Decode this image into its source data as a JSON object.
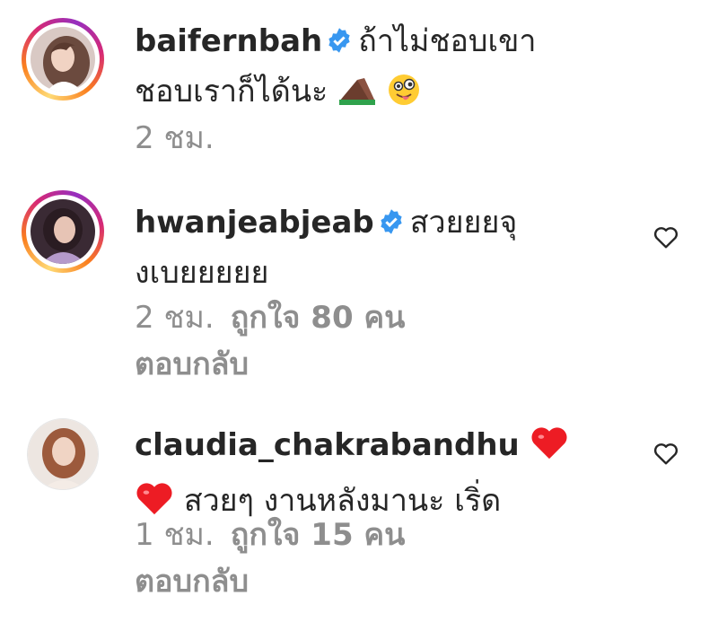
{
  "comments": [
    {
      "username": "baifernbah",
      "verified": true,
      "text_line1": "ถ้าไม่ชอบเขา",
      "text_line2": "ชอบเราก็ได้นะ",
      "time": "2 ชม.",
      "likes": "",
      "reply": "",
      "emojis": [
        "chocolate-cake-emoji",
        "winking-tongue-face-emoji"
      ]
    },
    {
      "username": "hwanjeabjeab",
      "verified": true,
      "text_line1": "สวยยยจุ",
      "text_line2": "งเบยยยยย",
      "time": "2 ชม.",
      "likes": "ถูกใจ 80 คน",
      "reply": "ตอบกลับ"
    },
    {
      "username": "claudia_chakrabandhu",
      "verified": false,
      "text_line1": "",
      "text_line2": "สวยๆ งานหลังมานะ เริ่ด",
      "time": "1 ชม.",
      "likes": "ถูกใจ 15 คน",
      "reply": "ตอบกลับ",
      "emojis": [
        "red-heart-emoji",
        "red-heart-emoji"
      ]
    }
  ],
  "colors": {
    "verified": "#3897f0",
    "muted": "#8e8e8e",
    "text": "#262626",
    "heart_emoji": "#ed1c24"
  },
  "icons": [
    "verified-badge-icon",
    "heart-outline-icon"
  ]
}
